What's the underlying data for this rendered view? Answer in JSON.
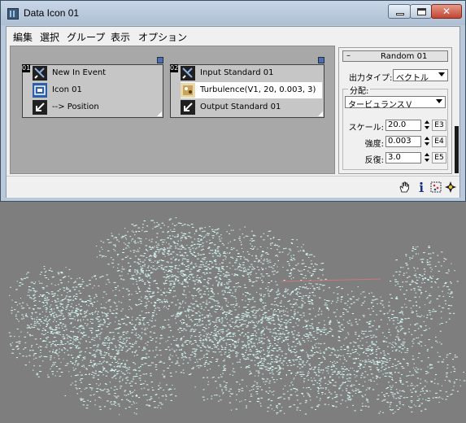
{
  "window": {
    "title": "Data Icon 01",
    "close_symbol": "✕"
  },
  "menu": [
    "編集",
    "選択",
    "グループ",
    "表示",
    "オプション"
  ],
  "nodes": [
    {
      "number": "01",
      "rows": [
        "New In Event",
        "Icon 01",
        "--> Position"
      ]
    },
    {
      "number": "02",
      "rows": [
        "Input Standard 01",
        "Turbulence(V1, 20, 0.003, 3)",
        "Output Standard 01"
      ]
    }
  ],
  "panel": {
    "collapse_symbol": "–",
    "title": "Random 01",
    "output_type_label": "出力タイプ:",
    "output_type_value": "ベクトル",
    "distribution_label": "分配:",
    "distribution_value": "タービュランスＶ",
    "params": [
      {
        "label": "スケール:",
        "value": "20.0",
        "expr": "E3"
      },
      {
        "label": "強度:",
        "value": "0.003",
        "expr": "E4"
      },
      {
        "label": "反復:",
        "value": "3.0",
        "expr": "E5"
      }
    ]
  },
  "toolbar_icons": [
    "hand-icon",
    "info-icon",
    "particle-icon",
    "navigate-icon"
  ],
  "colors": {
    "particles": "#d6fbf4",
    "viewport_bg": "#7e7e7e",
    "node_selected": "#ffffff"
  }
}
